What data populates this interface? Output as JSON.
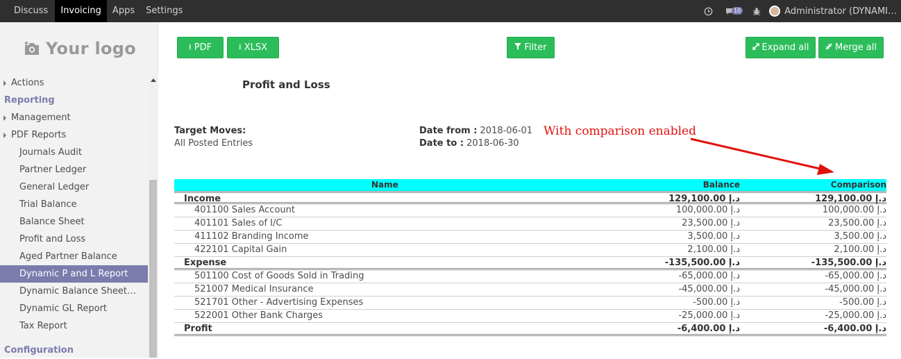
{
  "navbar": {
    "menu": [
      "Discuss",
      "Invoicing",
      "Apps",
      "Settings"
    ],
    "active": "Invoicing",
    "chat_count": "10",
    "user": "Administrator (DYNAMI…"
  },
  "sidebar": {
    "logo_text": "Your logo",
    "items": [
      {
        "label": "Actions",
        "type": "lvl0"
      },
      {
        "label": "Reporting",
        "type": "section"
      },
      {
        "label": "Management",
        "type": "lvl0"
      },
      {
        "label": "PDF Reports",
        "type": "lvl0"
      },
      {
        "label": "Journals Audit",
        "type": "lvl1"
      },
      {
        "label": "Partner Ledger",
        "type": "lvl1"
      },
      {
        "label": "General Ledger",
        "type": "lvl1"
      },
      {
        "label": "Trial Balance",
        "type": "lvl1"
      },
      {
        "label": "Balance Sheet",
        "type": "lvl1"
      },
      {
        "label": "Profit and Loss",
        "type": "lvl1"
      },
      {
        "label": "Aged Partner Balance",
        "type": "lvl1"
      },
      {
        "label": "Dynamic P and L Report",
        "type": "lvl1",
        "active": true
      },
      {
        "label": "Dynamic Balance Sheet…",
        "type": "lvl1"
      },
      {
        "label": "Dynamic GL Report",
        "type": "lvl1"
      },
      {
        "label": "Tax Report",
        "type": "lvl1"
      },
      {
        "label": "",
        "type": "spacer"
      },
      {
        "label": "Configuration",
        "type": "section"
      }
    ]
  },
  "toolbar": {
    "pdf": "PDF",
    "xlsx": "XLSX",
    "filter": "Filter",
    "expand_all": "Expand all",
    "merge_all": "Merge all"
  },
  "report": {
    "title": "Profit and Loss",
    "target_moves_label": "Target Moves:",
    "target_moves_value": "All Posted Entries",
    "date_from_label": "Date from :",
    "date_from": "2018-06-01",
    "date_to_label": "Date to :",
    "date_to": "2018-06-30",
    "annotation": "With comparison enabled"
  },
  "table": {
    "headers": {
      "name": "Name",
      "balance": "Balance",
      "comparison": "Comparison"
    },
    "rows": [
      {
        "name": "Income",
        "balance": "129,100.00 د.إ",
        "comparison": "129,100.00 د.إ",
        "group": true
      },
      {
        "name": "401100 Sales Account",
        "balance": "100,000.00 د.إ",
        "comparison": "100,000.00 د.إ"
      },
      {
        "name": "401101 Sales of I/C",
        "balance": "23,500.00 د.إ",
        "comparison": "23,500.00 د.إ"
      },
      {
        "name": "411102 Branding Income",
        "balance": "3,500.00 د.إ",
        "comparison": "3,500.00 د.إ"
      },
      {
        "name": "422101 Capital Gain",
        "balance": "2,100.00 د.إ",
        "comparison": "2,100.00 د.إ"
      },
      {
        "name": "Expense",
        "balance": "-135,500.00 د.إ",
        "comparison": "-135,500.00 د.إ",
        "group": true
      },
      {
        "name": "501100 Cost of Goods Sold in Trading",
        "balance": "-65,000.00 د.إ",
        "comparison": "-65,000.00 د.إ"
      },
      {
        "name": "521007 Medical Insurance",
        "balance": "-45,000.00 د.إ",
        "comparison": "-45,000.00 د.إ"
      },
      {
        "name": "521701 Other - Advertising Expenses",
        "balance": "-500.00 د.إ",
        "comparison": "-500.00 د.إ"
      },
      {
        "name": "522001 Other Bank Charges",
        "balance": "-25,000.00 د.إ",
        "comparison": "-25,000.00 د.إ"
      },
      {
        "name": "Profit",
        "balance": "-6,400.00 د.إ",
        "comparison": "-6,400.00 د.إ",
        "group": true
      }
    ]
  },
  "colors": {
    "navbar": "#2f2f2f",
    "accent": "#7c7bad",
    "button": "#2bbd5a",
    "table_header": "#00ffff",
    "annotation": "#e0110b"
  }
}
